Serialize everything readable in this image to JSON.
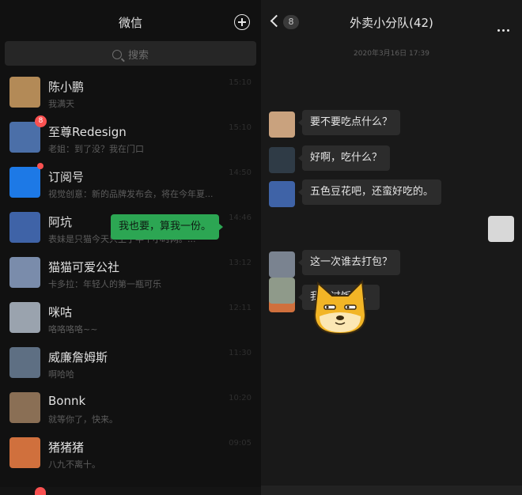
{
  "left": {
    "title": "微信",
    "search_placeholder": "搜索",
    "chats": [
      {
        "name": "陈小鹏",
        "preview": "我满天",
        "time": "15:10",
        "avatar": "#b38a57",
        "badge": ""
      },
      {
        "name": "至尊Redesign",
        "preview": "老姐：到了没？我在门口",
        "time": "15:10",
        "avatar": "#4b6fa8",
        "badge": "8"
      },
      {
        "name": "订阅号",
        "preview": "视觉创意：新的品牌发布会，将在今年夏...",
        "time": "14:50",
        "avatar": "#1d79e6",
        "badge": "dot"
      },
      {
        "name": "阿坑",
        "preview": "表妹是只猫今天只上了半个小时网。...",
        "time": "14:46",
        "avatar": "#3f63a7",
        "badge": ""
      },
      {
        "name": "猫猫可爱公社",
        "preview": "卡多拉：年轻人的第一瓶可乐",
        "time": "13:12",
        "avatar": "#7a8cab",
        "badge": ""
      },
      {
        "name": "咪咕",
        "preview": "咯咯咯咯~~",
        "time": "12:11",
        "avatar": "#9aa3ae",
        "badge": ""
      },
      {
        "name": "威廉詹姆斯",
        "preview": "啊哈哈",
        "time": "11:30",
        "avatar": "#5e6f83",
        "badge": ""
      },
      {
        "name": "Bonnk",
        "preview": "就等你了，快来。",
        "time": "10:20",
        "avatar": "#8a6f55",
        "badge": ""
      },
      {
        "name": "猪猪猪",
        "preview": "八九不离十。",
        "time": "09:05",
        "avatar": "#d0703d",
        "badge": ""
      }
    ],
    "tab_badge": "8"
  },
  "right": {
    "unread_count": "8",
    "title": "外卖小分队(42)",
    "timestamp": "2020年3月16日 17:39",
    "messages": [
      {
        "side": "left",
        "text": "要不要吃点什么？",
        "avatar": "#c9a27e"
      },
      {
        "side": "left",
        "text": "好啊，吃什么？",
        "avatar": "#2f3b46"
      },
      {
        "side": "left",
        "text": "五色豆花吧，还蛮好吃的。",
        "avatar": "#3f63a7"
      },
      {
        "side": "right",
        "text": "我也要，算我一份。",
        "avatar": "#d8d8d8"
      },
      {
        "side": "left",
        "text": "这一次谁去打包？",
        "avatar": "#7a8390"
      },
      {
        "side": "left",
        "text": "我吃过饭了。",
        "avatar": "#d0703d"
      }
    ],
    "sticker_avatar": "#8f9a8a",
    "sticker": "doge"
  }
}
